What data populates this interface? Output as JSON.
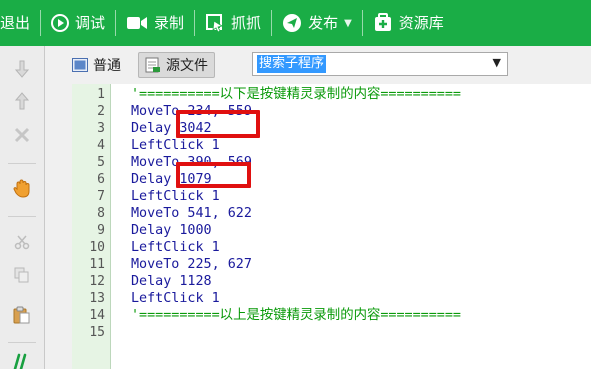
{
  "toolbar": {
    "exit_label": "退出",
    "debug_label": "调试",
    "record_label": "录制",
    "capture_label": "抓抓",
    "publish_label": "发布",
    "resources_label": "资源库"
  },
  "tabs": {
    "normal_label": "普通",
    "source_label": "源文件",
    "active": "源文件"
  },
  "sub_select": {
    "value": "搜索子程序"
  },
  "editor": {
    "line_numbers": [
      "1",
      "2",
      "3",
      "4",
      "5",
      "6",
      "7",
      "8",
      "9",
      "10",
      "11",
      "12",
      "13",
      "14",
      "15"
    ],
    "lines": [
      "'==========以下是按键精灵录制的内容==========",
      "MoveTo 234, 559",
      "Delay 3042",
      "LeftClick 1",
      "MoveTo 390, 569",
      "Delay 1079",
      "LeftClick 1",
      "MoveTo 541, 622",
      "Delay 1000",
      "LeftClick 1",
      "MoveTo 225, 627",
      "Delay 1128",
      "LeftClick 1",
      "'==========以上是按键精灵录制的内容==========",
      ""
    ]
  },
  "colors": {
    "toolbar_bg": "#1aad46",
    "comment": "#0a9a0a",
    "code": "#1a1a9c",
    "highlight_box": "#e01010",
    "gutter_bg": "#e6f4e4"
  },
  "icons": [
    "exit-icon",
    "play-icon",
    "camera-icon",
    "capture-icon",
    "send-icon",
    "plus-box-icon",
    "down-icon",
    "up-icon",
    "stop-icon",
    "hand-icon",
    "scissors-icon",
    "copy-icon",
    "paste-icon",
    "comment-icon",
    "doc-icon",
    "code-file-icon"
  ]
}
